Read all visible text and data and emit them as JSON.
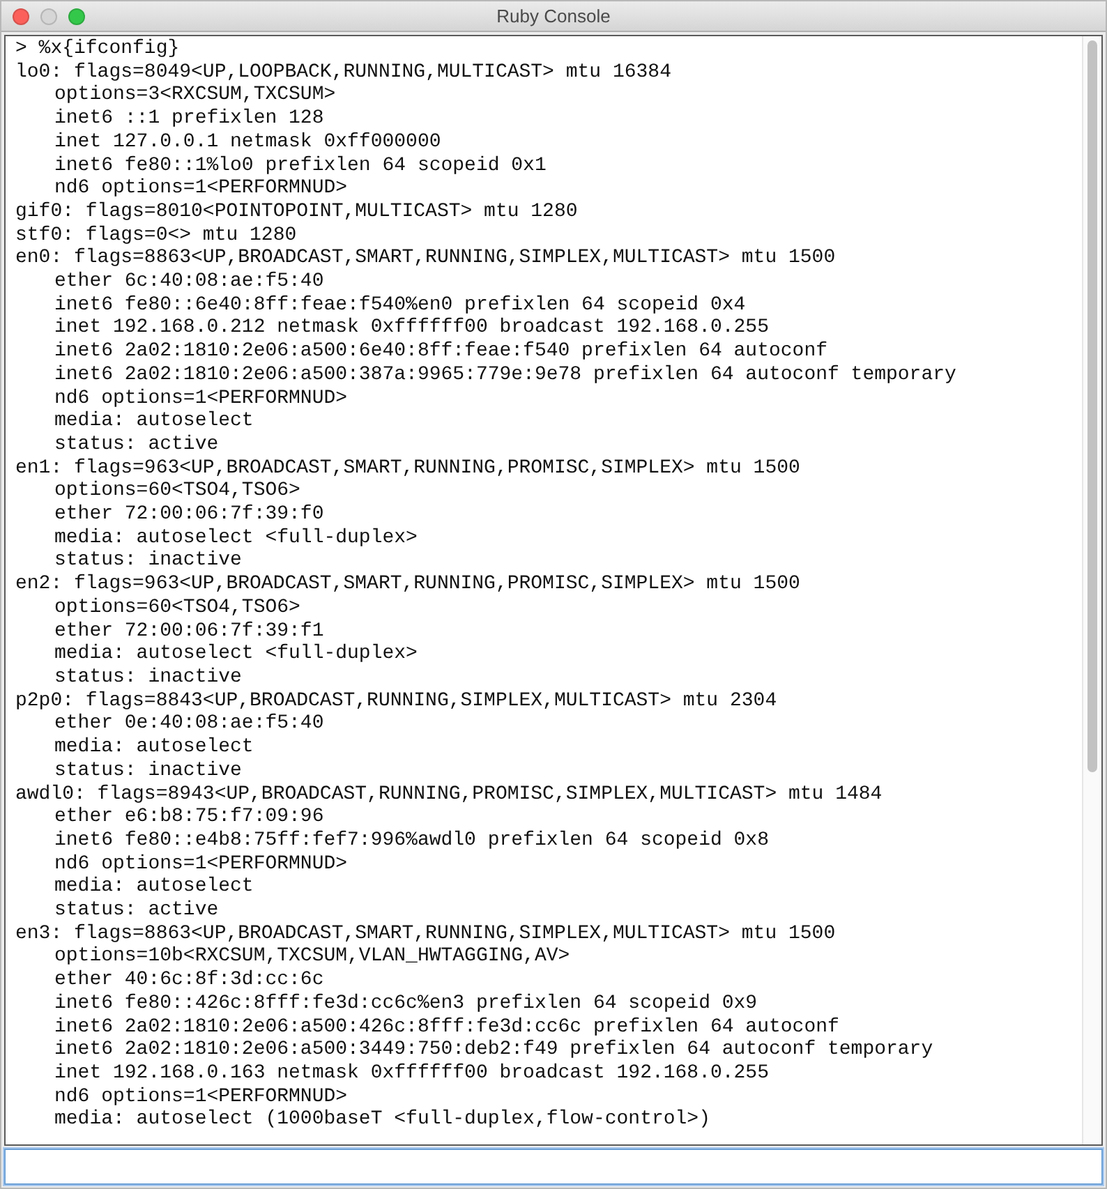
{
  "window": {
    "title": "Ruby Console"
  },
  "console": {
    "prompt": "> %x{ifconfig}",
    "interfaces": [
      {
        "header": "lo0: flags=8049<UP,LOOPBACK,RUNNING,MULTICAST> mtu 16384",
        "details": [
          "options=3<RXCSUM,TXCSUM>",
          "inet6 ::1 prefixlen 128",
          "inet 127.0.0.1 netmask 0xff000000",
          "inet6 fe80::1%lo0 prefixlen 64 scopeid 0x1",
          "nd6 options=1<PERFORMNUD>"
        ]
      },
      {
        "header": "gif0: flags=8010<POINTOPOINT,MULTICAST> mtu 1280"
      },
      {
        "header": "stf0: flags=0<> mtu 1280"
      },
      {
        "header": "en0: flags=8863<UP,BROADCAST,SMART,RUNNING,SIMPLEX,MULTICAST> mtu 1500",
        "details": [
          "ether 6c:40:08:ae:f5:40",
          "inet6 fe80::6e40:8ff:feae:f540%en0 prefixlen 64 scopeid 0x4",
          "inet 192.168.0.212 netmask 0xffffff00 broadcast 192.168.0.255",
          "inet6 2a02:1810:2e06:a500:6e40:8ff:feae:f540 prefixlen 64 autoconf",
          "inet6 2a02:1810:2e06:a500:387a:9965:779e:9e78 prefixlen 64 autoconf temporary",
          "nd6 options=1<PERFORMNUD>",
          "media: autoselect",
          "status: active"
        ]
      },
      {
        "header": "en1: flags=963<UP,BROADCAST,SMART,RUNNING,PROMISC,SIMPLEX> mtu 1500",
        "details": [
          "options=60<TSO4,TSO6>",
          "ether 72:00:06:7f:39:f0",
          "media: autoselect <full-duplex>",
          "status: inactive"
        ]
      },
      {
        "header": "en2: flags=963<UP,BROADCAST,SMART,RUNNING,PROMISC,SIMPLEX> mtu 1500",
        "details": [
          "options=60<TSO4,TSO6>",
          "ether 72:00:06:7f:39:f1",
          "media: autoselect <full-duplex>",
          "status: inactive"
        ]
      },
      {
        "header": "p2p0: flags=8843<UP,BROADCAST,RUNNING,SIMPLEX,MULTICAST> mtu 2304",
        "details": [
          "ether 0e:40:08:ae:f5:40",
          "media: autoselect",
          "status: inactive"
        ]
      },
      {
        "header": "awdl0: flags=8943<UP,BROADCAST,RUNNING,PROMISC,SIMPLEX,MULTICAST> mtu 1484",
        "details": [
          "ether e6:b8:75:f7:09:96",
          "inet6 fe80::e4b8:75ff:fef7:996%awdl0 prefixlen 64 scopeid 0x8",
          "nd6 options=1<PERFORMNUD>",
          "media: autoselect",
          "status: active"
        ]
      },
      {
        "header": "en3: flags=8863<UP,BROADCAST,SMART,RUNNING,SIMPLEX,MULTICAST> mtu 1500",
        "details": [
          "options=10b<RXCSUM,TXCSUM,VLAN_HWTAGGING,AV>",
          "ether 40:6c:8f:3d:cc:6c",
          "inet6 fe80::426c:8fff:fe3d:cc6c%en3 prefixlen 64 scopeid 0x9",
          "inet6 2a02:1810:2e06:a500:426c:8fff:fe3d:cc6c prefixlen 64 autoconf",
          "inet6 2a02:1810:2e06:a500:3449:750:deb2:f49 prefixlen 64 autoconf temporary",
          "inet 192.168.0.163 netmask 0xffffff00 broadcast 192.168.0.255",
          "nd6 options=1<PERFORMNUD>",
          "media: autoselect (1000baseT <full-duplex,flow-control>)"
        ]
      }
    ]
  }
}
